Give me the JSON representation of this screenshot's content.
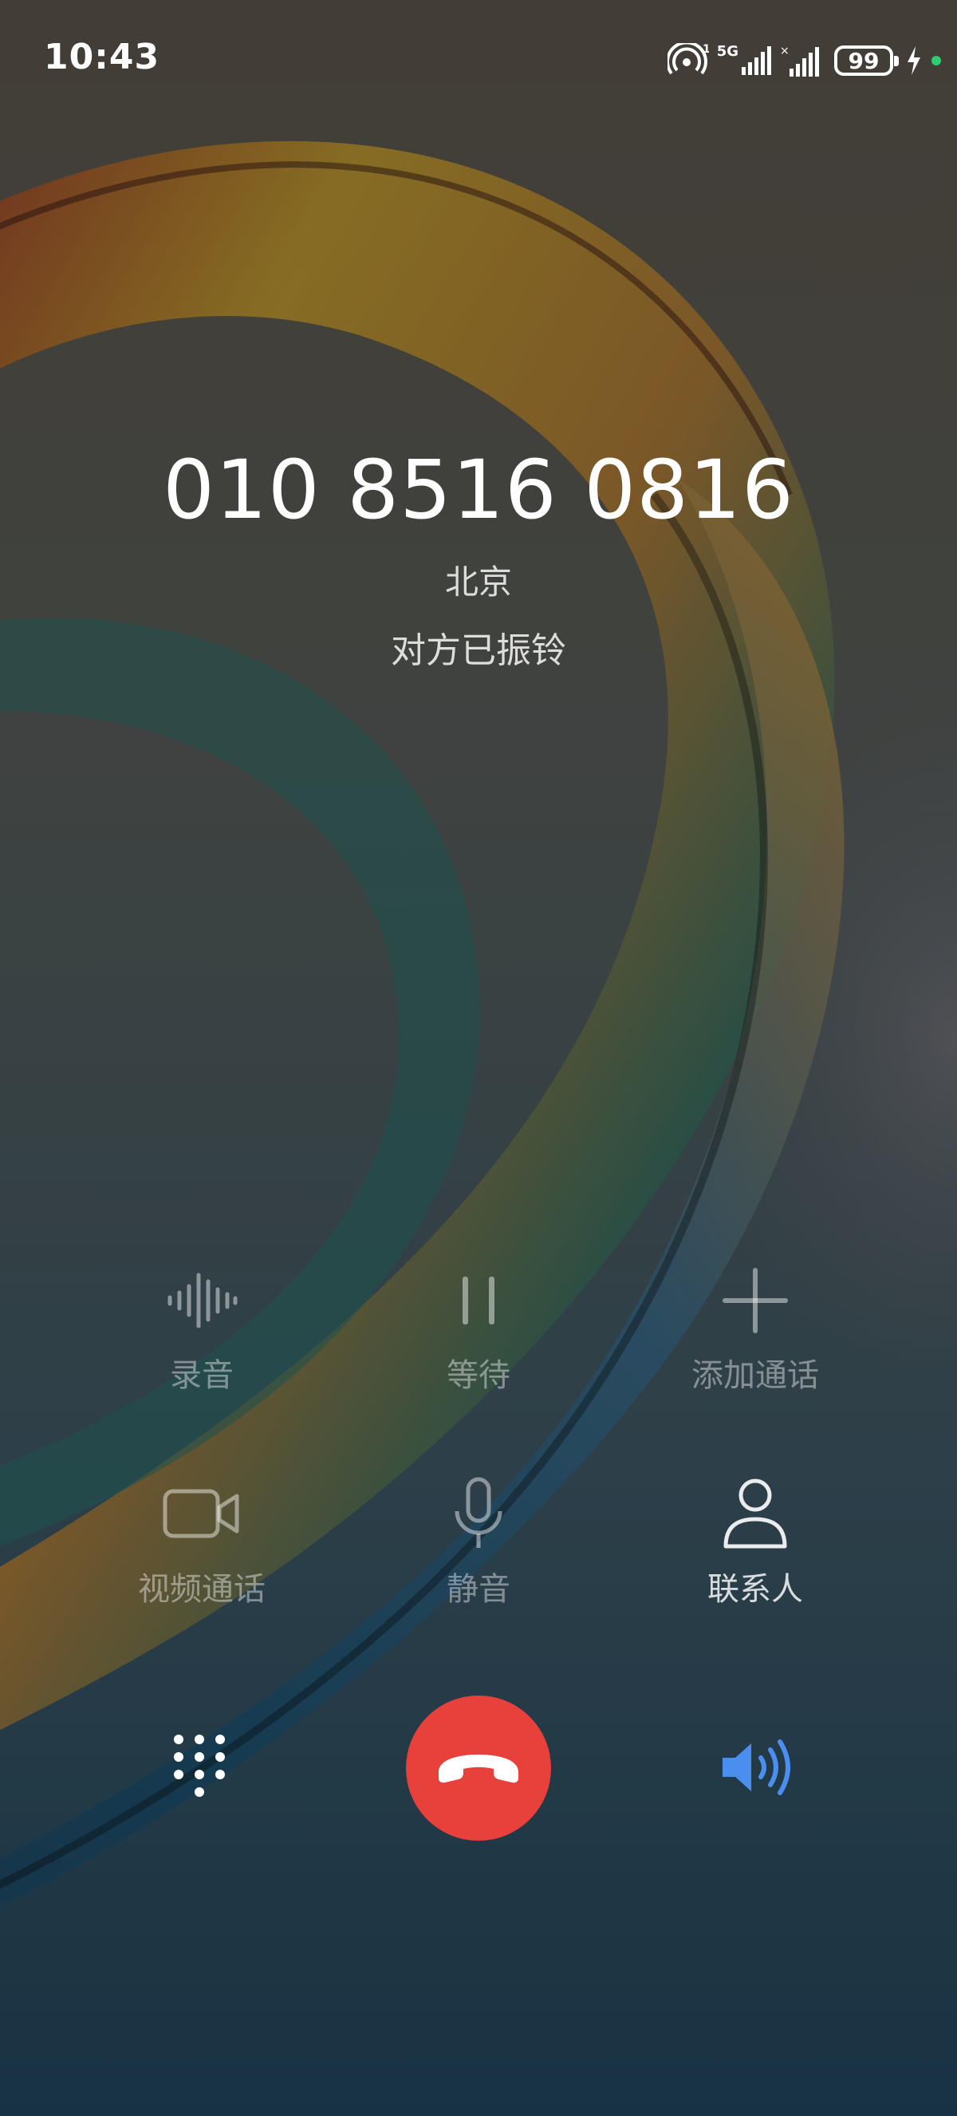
{
  "status_bar": {
    "time": "10:43",
    "network_label": "5G",
    "battery_level": "99",
    "sim1_label": "1"
  },
  "caller": {
    "number": "010 8516 0816",
    "location": "北京",
    "status": "对方已振铃"
  },
  "actions": {
    "record": {
      "label": "录音",
      "icon": "waveform-icon",
      "enabled": false
    },
    "hold": {
      "label": "等待",
      "icon": "pause-icon",
      "enabled": false
    },
    "add_call": {
      "label": "添加通话",
      "icon": "plus-icon",
      "enabled": false
    },
    "video_call": {
      "label": "视频通话",
      "icon": "video-camera-icon",
      "enabled": false
    },
    "mute": {
      "label": "静音",
      "icon": "microphone-icon",
      "enabled": false
    },
    "contacts": {
      "label": "联系人",
      "icon": "person-icon",
      "enabled": true
    }
  },
  "bottom": {
    "dialpad_icon": "dialpad-icon",
    "end_call_icon": "hang-up-icon",
    "speaker_icon": "speaker-icon"
  },
  "colors": {
    "end_call": "#e8403a",
    "speaker_active": "#4a8ff0",
    "indicator_dot": "#2ecc71"
  }
}
